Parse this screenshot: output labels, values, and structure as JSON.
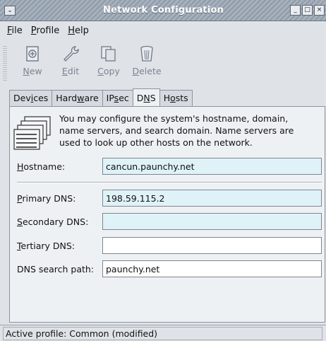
{
  "window": {
    "title": "Network Configuration",
    "menu_glyph": "⌄",
    "minimize": "_",
    "maximize": "□",
    "close": "×"
  },
  "menubar": {
    "file": {
      "mnemonic": "F",
      "rest": "ile"
    },
    "profile": {
      "mnemonic": "P",
      "rest": "rofile"
    },
    "help": {
      "mnemonic": "H",
      "rest": "elp"
    }
  },
  "toolbar": {
    "new": {
      "mnemonic": "N",
      "rest": "ew"
    },
    "edit": {
      "mnemonic": "E",
      "rest": "dit"
    },
    "copy": {
      "mnemonic": "C",
      "rest": "opy"
    },
    "delete": {
      "mnemonic": "D",
      "rest": "elete"
    }
  },
  "tabs": {
    "devices": {
      "pre": "Dev",
      "mnemonic": "i",
      "post": "ces"
    },
    "hardware": {
      "pre": "Hard",
      "mnemonic": "w",
      "post": "are"
    },
    "ipsec": {
      "pre": "IP",
      "mnemonic": "s",
      "post": "ec"
    },
    "dns": {
      "pre": "D",
      "mnemonic": "N",
      "post": "S"
    },
    "hosts": {
      "pre": "H",
      "mnemonic": "o",
      "post": "sts"
    }
  },
  "dns": {
    "info_line1": "You may configure the system's hostname, domain,",
    "info_line2": "name servers, and search domain. Name servers are",
    "info_line3": "used to look up other hosts on the network.",
    "hostname": {
      "mnemonic": "H",
      "rest": "ostname:",
      "value": "cancun.paunchy.net"
    },
    "primary": {
      "mnemonic": "P",
      "rest": "rimary DNS:",
      "value": "198.59.115.2"
    },
    "secondary": {
      "mnemonic": "S",
      "rest": "econdary DNS:",
      "value": ""
    },
    "tertiary": {
      "mnemonic": "T",
      "rest": "ertiary DNS:",
      "value": ""
    },
    "search": {
      "label": "DNS search path:",
      "value": "paunchy.net"
    }
  },
  "status": {
    "text": "Active profile: Common (modified)"
  }
}
